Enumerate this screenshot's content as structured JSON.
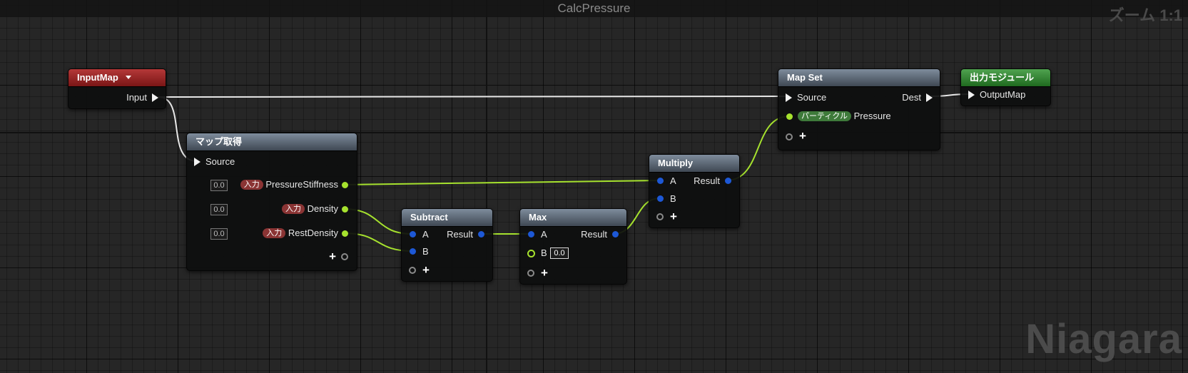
{
  "graph": {
    "title": "CalcPressure",
    "zoom": "ズーム 1:1",
    "watermark": "Niagara"
  },
  "colors": {
    "float_pin": "#a6e22e",
    "vector_pin": "#1d58d6",
    "map_pin": "#f2f2f2",
    "input_header": "#9a2525",
    "output_header": "#2f8a2f",
    "function_header": "#5b6877"
  },
  "nodes": {
    "input_map": {
      "title": "InputMap",
      "icon": "chevron-down-icon",
      "output": "Input"
    },
    "map_get": {
      "title": "マップ取得",
      "input": "Source",
      "outputs": [
        {
          "value": "0.0",
          "tag": "入力",
          "name": "PressureStiffness"
        },
        {
          "value": "0.0",
          "tag": "入力",
          "name": "Density"
        },
        {
          "value": "0.0",
          "tag": "入力",
          "name": "RestDensity"
        }
      ]
    },
    "subtract": {
      "title": "Subtract",
      "a": "A",
      "b": "B",
      "result": "Result"
    },
    "max": {
      "title": "Max",
      "a": "A",
      "b": "B",
      "b_value": "0.0",
      "result": "Result"
    },
    "multiply": {
      "title": "Multiply",
      "a": "A",
      "b": "B",
      "result": "Result"
    },
    "map_set": {
      "title": "Map Set",
      "source": "Source",
      "dest": "Dest",
      "tag": "パーティクル",
      "name": "Pressure"
    },
    "output_module": {
      "title": "出力モジュール",
      "input": "OutputMap"
    }
  }
}
